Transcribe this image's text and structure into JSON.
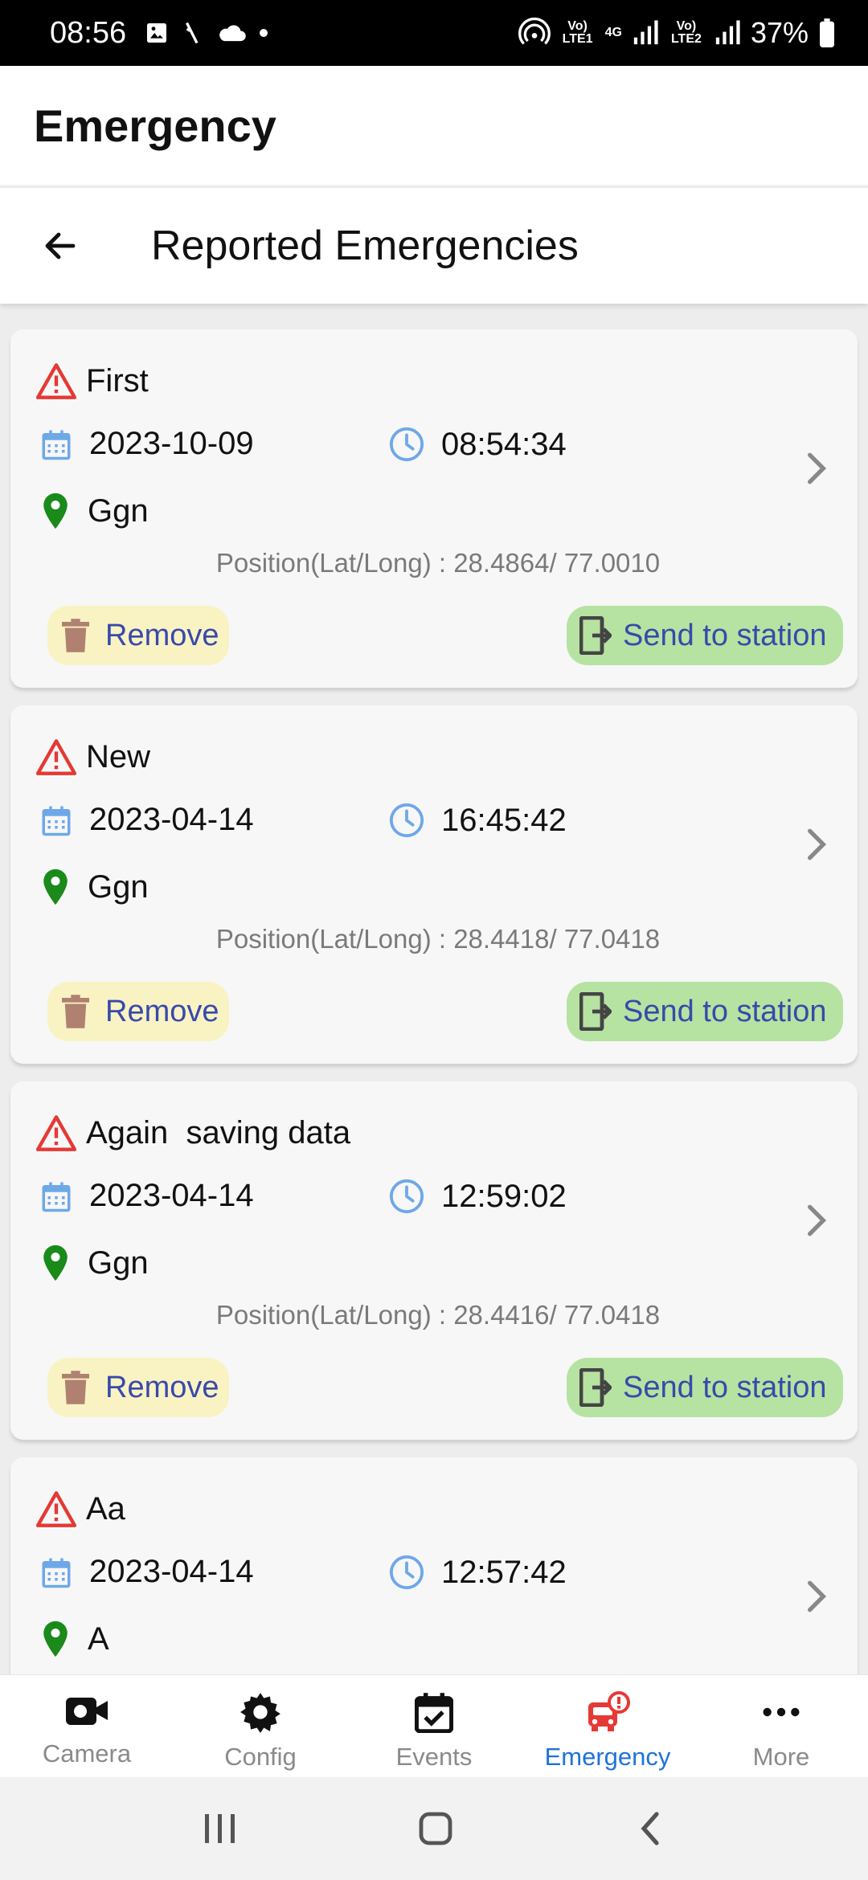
{
  "status_bar": {
    "time": "08:56",
    "lte1": "Vo) LTE1",
    "network": "4G",
    "lte2": "Vo) LTE2",
    "battery": "37%"
  },
  "app_bar": {
    "title": "Emergency"
  },
  "sub_header": {
    "title": "Reported Emergencies"
  },
  "emergencies": [
    {
      "name": "First",
      "date": "2023-10-09",
      "time": "08:54:34",
      "location": "Ggn",
      "position": "Position(Lat/Long) : 28.4864/ 77.0010"
    },
    {
      "name": "New",
      "date": "2023-04-14",
      "time": "16:45:42",
      "location": "Ggn",
      "position": "Position(Lat/Long) : 28.4418/ 77.0418"
    },
    {
      "name": "Again  saving data",
      "date": "2023-04-14",
      "time": "12:59:02",
      "location": "Ggn",
      "position": "Position(Lat/Long) : 28.4416/ 77.0418"
    },
    {
      "name": "Aa",
      "date": "2023-04-14",
      "time": "12:57:42",
      "location": "A",
      "position": ""
    }
  ],
  "actions": {
    "remove_label": "Remove",
    "send_label": "Send to station"
  },
  "bottom_nav": [
    {
      "label": "Camera",
      "icon": "camera-icon"
    },
    {
      "label": "Config",
      "icon": "gear-icon"
    },
    {
      "label": "Events",
      "icon": "calendar-check-icon"
    },
    {
      "label": "Emergency",
      "icon": "emergency-vehicle-icon",
      "active": true
    },
    {
      "label": "More",
      "icon": "more-dots-icon"
    }
  ],
  "colors": {
    "alert": "#e53935",
    "calendar": "#6fa8e8",
    "location": "#1a8a1a",
    "remove_bg": "#f9f3c4",
    "send_bg": "#b6e3a1",
    "button_text": "#3949ab",
    "active_nav": "#1e73d8"
  }
}
